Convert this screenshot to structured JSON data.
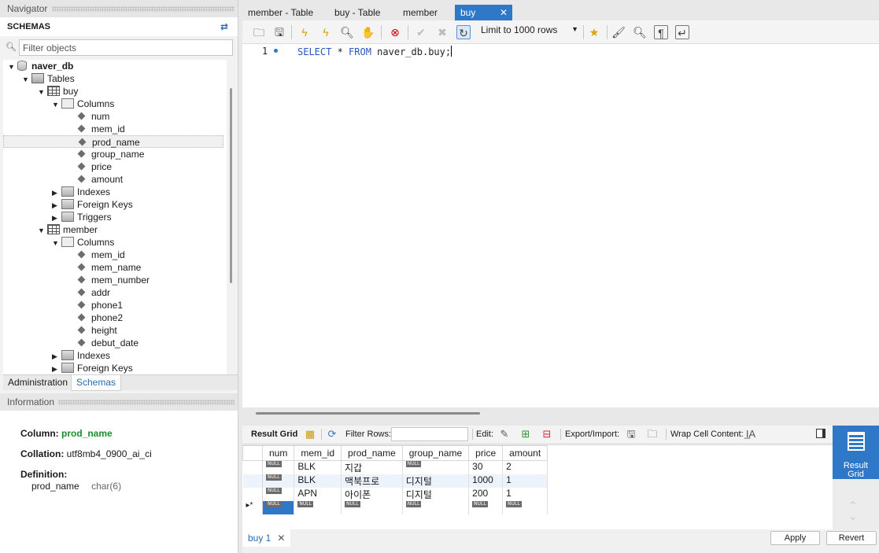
{
  "navigator": {
    "title": "Navigator",
    "schemas_title": "SCHEMAS",
    "filter_placeholder": "Filter objects",
    "tree": [
      {
        "label": "naver_db",
        "level": 0,
        "arrow": "▼",
        "icon": "database-icon",
        "bold": true
      },
      {
        "label": "Tables",
        "level": 1,
        "arrow": "▼",
        "icon": "folder-icon"
      },
      {
        "label": "buy",
        "level": 2,
        "arrow": "▼",
        "icon": "table-icon"
      },
      {
        "label": "Columns",
        "level": 3,
        "arrow": "▼",
        "icon": "columns-icon"
      },
      {
        "label": "num",
        "level": 4,
        "icon": "column-icon"
      },
      {
        "label": "mem_id",
        "level": 4,
        "icon": "column-icon"
      },
      {
        "label": "prod_name",
        "level": 4,
        "icon": "column-icon",
        "selected": true
      },
      {
        "label": "group_name",
        "level": 4,
        "icon": "column-icon"
      },
      {
        "label": "price",
        "level": 4,
        "icon": "column-icon"
      },
      {
        "label": "amount",
        "level": 4,
        "icon": "column-icon"
      },
      {
        "label": "Indexes",
        "level": 3,
        "arrow": "▶",
        "icon": "indexes-icon"
      },
      {
        "label": "Foreign Keys",
        "level": 3,
        "arrow": "▶",
        "icon": "foreign-keys-icon"
      },
      {
        "label": "Triggers",
        "level": 3,
        "arrow": "▶",
        "icon": "triggers-icon"
      },
      {
        "label": "member",
        "level": 2,
        "arrow": "▼",
        "icon": "table-icon"
      },
      {
        "label": "Columns",
        "level": 3,
        "arrow": "▼",
        "icon": "columns-icon"
      },
      {
        "label": "mem_id",
        "level": 4,
        "icon": "column-icon"
      },
      {
        "label": "mem_name",
        "level": 4,
        "icon": "column-icon"
      },
      {
        "label": "mem_number",
        "level": 4,
        "icon": "column-icon"
      },
      {
        "label": "addr",
        "level": 4,
        "icon": "column-icon"
      },
      {
        "label": "phone1",
        "level": 4,
        "icon": "column-icon"
      },
      {
        "label": "phone2",
        "level": 4,
        "icon": "column-icon"
      },
      {
        "label": "height",
        "level": 4,
        "icon": "column-icon"
      },
      {
        "label": "debut_date",
        "level": 4,
        "icon": "column-icon"
      },
      {
        "label": "Indexes",
        "level": 3,
        "arrow": "▶",
        "icon": "indexes-icon"
      },
      {
        "label": "Foreign Keys",
        "level": 3,
        "arrow": "▶",
        "icon": "foreign-keys-icon"
      }
    ],
    "tabs": {
      "administration": "Administration",
      "schemas": "Schemas"
    }
  },
  "information": {
    "title": "Information",
    "column_label": "Column:",
    "column_value": "prod_name",
    "collation_label": "Collation:",
    "collation_value": "utf8mb4_0900_ai_ci",
    "definition_label": "Definition:",
    "definition_name": "prod_name",
    "definition_type": "char(6)"
  },
  "editor_tabs": [
    {
      "label": "member - Table"
    },
    {
      "label": "buy - Table"
    },
    {
      "label": "member"
    },
    {
      "label": "buy",
      "active": true
    }
  ],
  "toolbar": {
    "limit_label": "Limit to 1000 rows"
  },
  "editor": {
    "line_number": "1",
    "code": {
      "k1": "SELECT",
      "sym": " * ",
      "k2": "FROM",
      "rest": " naver_db.buy;"
    }
  },
  "result_toolbar": {
    "result_grid": "Result Grid",
    "filter_rows": "Filter Rows:",
    "edit": "Edit:",
    "export_import": "Export/Import:",
    "wrap_cell": "Wrap Cell Content:"
  },
  "grid": {
    "columns": [
      "num",
      "mem_id",
      "prod_name",
      "group_name",
      "price",
      "amount"
    ],
    "null_label": "NULL",
    "new_row_marker": "▸*",
    "rows": [
      [
        null,
        "BLK",
        "지갑",
        null,
        "30",
        "2"
      ],
      [
        null,
        "BLK",
        "맥북프로",
        "디지털",
        "1000",
        "1"
      ],
      [
        null,
        "APN",
        "아이폰",
        "디지털",
        "200",
        "1"
      ]
    ]
  },
  "bottom": {
    "result_tab": "buy 1",
    "apply": "Apply",
    "revert": "Revert"
  },
  "side_panel": {
    "result_grid_line1": "Result",
    "result_grid_line2": "Grid"
  },
  "colors": {
    "accent": "#2f78c8",
    "info_green": "#1c8e2b"
  }
}
